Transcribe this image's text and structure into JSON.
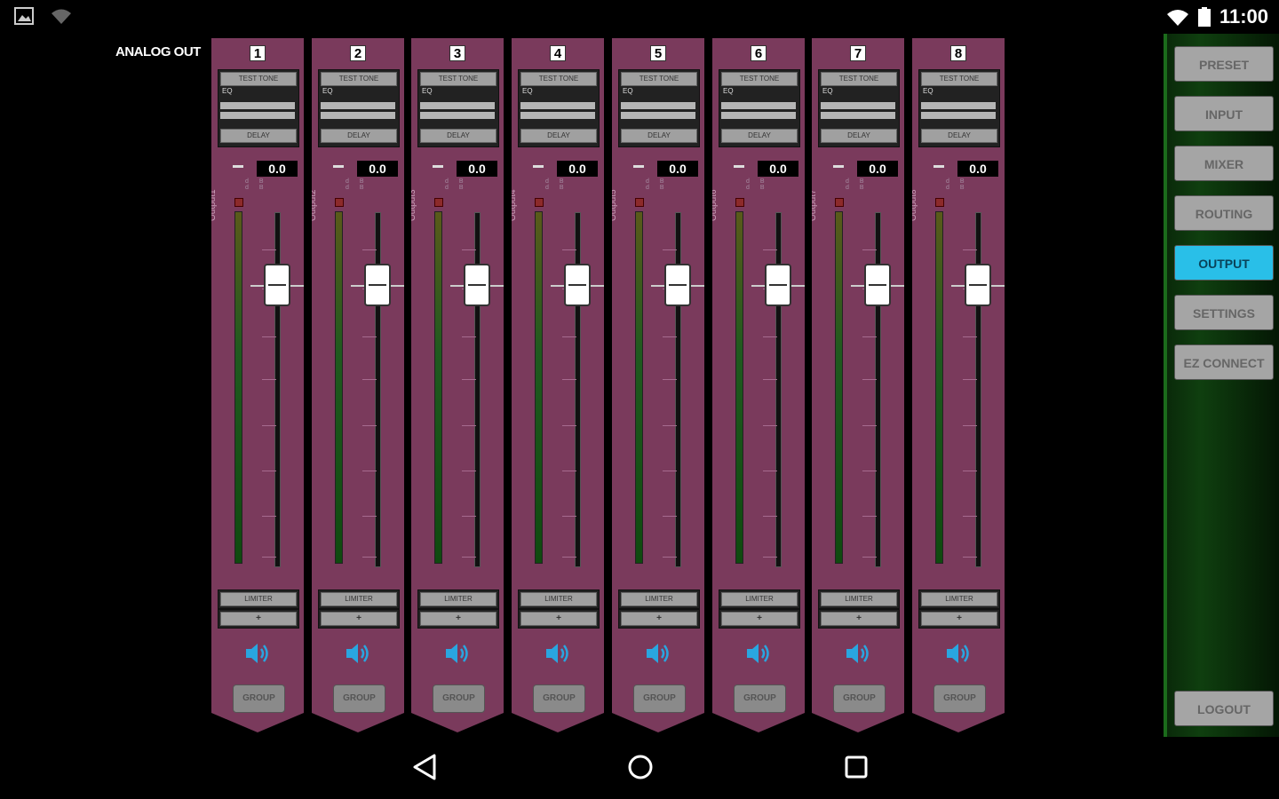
{
  "status_bar": {
    "time": "11:00",
    "left_icons": [
      "image-icon",
      "wifi-icon"
    ],
    "right_icons": [
      "wifi-signal-icon",
      "battery-icon"
    ]
  },
  "section_title": "ANALOG OUT",
  "channels": [
    {
      "number": "1",
      "test_tone": "TEST TONE",
      "eq": "EQ",
      "delay": "DELAY",
      "dash": "—",
      "db": "0.0",
      "db_ticks": "dB dB",
      "output": "Output1",
      "limiter": "LIMITER",
      "plus": "+",
      "group": "GROUP"
    },
    {
      "number": "2",
      "test_tone": "TEST TONE",
      "eq": "EQ",
      "delay": "DELAY",
      "dash": "—",
      "db": "0.0",
      "db_ticks": "dB dB",
      "output": "Output2",
      "limiter": "LIMITER",
      "plus": "+",
      "group": "GROUP"
    },
    {
      "number": "3",
      "test_tone": "TEST TONE",
      "eq": "EQ",
      "delay": "DELAY",
      "dash": "—",
      "db": "0.0",
      "db_ticks": "dB dB",
      "output": "Output3",
      "limiter": "LIMITER",
      "plus": "+",
      "group": "GROUP"
    },
    {
      "number": "4",
      "test_tone": "TEST TONE",
      "eq": "EQ",
      "delay": "DELAY",
      "dash": "—",
      "db": "0.0",
      "db_ticks": "dB dB",
      "output": "Output4",
      "limiter": "LIMITER",
      "plus": "+",
      "group": "GROUP"
    },
    {
      "number": "5",
      "test_tone": "TEST TONE",
      "eq": "EQ",
      "delay": "DELAY",
      "dash": "—",
      "db": "0.0",
      "db_ticks": "dB dB",
      "output": "Output5",
      "limiter": "LIMITER",
      "plus": "+",
      "group": "GROUP"
    },
    {
      "number": "6",
      "test_tone": "TEST TONE",
      "eq": "EQ",
      "delay": "DELAY",
      "dash": "—",
      "db": "0.0",
      "db_ticks": "dB dB",
      "output": "Output6",
      "limiter": "LIMITER",
      "plus": "+",
      "group": "GROUP"
    },
    {
      "number": "7",
      "test_tone": "TEST TONE",
      "eq": "EQ",
      "delay": "DELAY",
      "dash": "—",
      "db": "0.0",
      "db_ticks": "dB dB",
      "output": "Output7",
      "limiter": "LIMITER",
      "plus": "+",
      "group": "GROUP"
    },
    {
      "number": "8",
      "test_tone": "TEST TONE",
      "eq": "EQ",
      "delay": "DELAY",
      "dash": "—",
      "db": "0.0",
      "db_ticks": "dB dB",
      "output": "Output8",
      "limiter": "LIMITER",
      "plus": "+",
      "group": "GROUP"
    }
  ],
  "nav": {
    "items": [
      {
        "label": "PRESET",
        "active": false
      },
      {
        "label": "INPUT",
        "active": false
      },
      {
        "label": "MIXER",
        "active": false
      },
      {
        "label": "ROUTING",
        "active": false
      },
      {
        "label": "OUTPUT",
        "active": true
      },
      {
        "label": "SETTINGS",
        "active": false
      },
      {
        "label": "EZ CONNECT",
        "active": false
      }
    ],
    "logout": "LOGOUT"
  },
  "colors": {
    "strip": "#7a3a5c",
    "active_nav": "#29bfe8",
    "nav_panel": "#0f3f0f"
  }
}
